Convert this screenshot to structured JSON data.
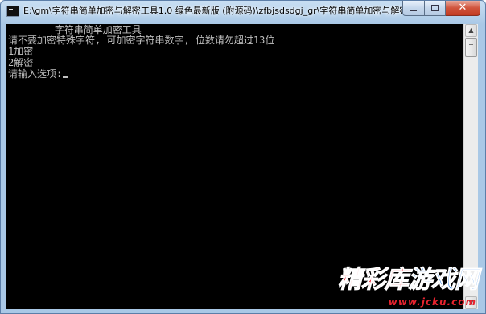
{
  "window": {
    "title": "E:\\gm\\字符串简单加密与解密工具1.0 绿色最新版 (附源码)\\zfbjsdsdgj_gr\\字符串简单加密与解密...",
    "app_icon": "console-icon",
    "buttons": {
      "minimize": "minimize-icon",
      "maximize": "maximize-icon",
      "close": "close-icon",
      "close_glyph": "✕"
    }
  },
  "console": {
    "lines": [
      "        字符串简单加密工具",
      "请不要加密特殊字符, 可加密字符串数字, 位数请勿超过13位",
      "1加密",
      "2解密",
      "请输入选项:"
    ],
    "text_color": "#c0c0c0",
    "background": "#000000"
  },
  "scrollbar": {
    "up_glyph": "▲",
    "down_glyph": "▼"
  },
  "watermark": {
    "name_part1": "精彩库",
    "name_part2": "游戏网",
    "url": "www.jcku.com"
  }
}
